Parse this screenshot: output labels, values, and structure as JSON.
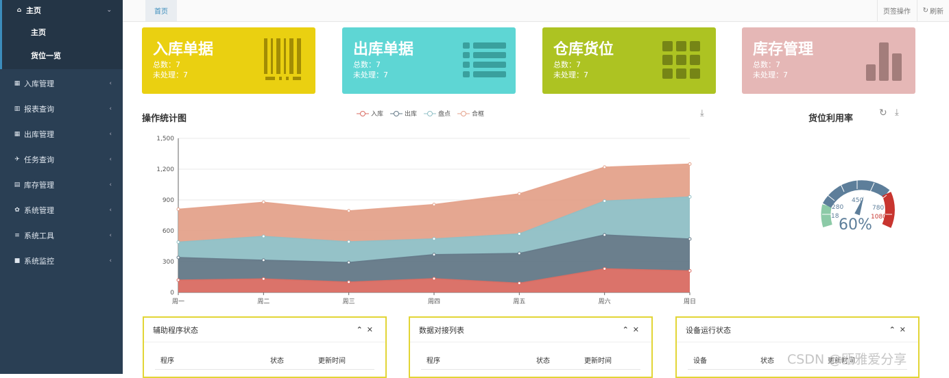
{
  "sidebar": {
    "main_label": "主页",
    "sub_items": [
      "主页",
      "货位一览"
    ],
    "menu": [
      {
        "label": "入库管理",
        "icon": "calculator-icon"
      },
      {
        "label": "报表查询",
        "icon": "bar-chart-icon"
      },
      {
        "label": "出库管理",
        "icon": "calculator-icon"
      },
      {
        "label": "任务查询",
        "icon": "plane-icon"
      },
      {
        "label": "库存管理",
        "icon": "book-icon"
      },
      {
        "label": "系统管理",
        "icon": "gear-icon"
      },
      {
        "label": "系统工具",
        "icon": "bars-icon"
      },
      {
        "label": "系统监控",
        "icon": "video-camera-icon"
      }
    ]
  },
  "topbar": {
    "tab": "首页",
    "page_ops": "页签操作",
    "refresh": "刷新"
  },
  "cards": [
    {
      "title": "入库单据",
      "total": "总数：7",
      "pending": "未处理：7",
      "color": "#ead011",
      "icon": "barcode-icon"
    },
    {
      "title": "出库单据",
      "total": "总数：7",
      "pending": "未处理：7",
      "color": "#5ed6d4",
      "icon": "list-icon"
    },
    {
      "title": "仓库货位",
      "total": "总数：7",
      "pending": "未处理：7",
      "color": "#adc322",
      "icon": "grid-icon"
    },
    {
      "title": "库存管理",
      "total": "总数：7",
      "pending": "未处理：7",
      "color": "#e5b7b6",
      "icon": "bar-chart-icon"
    }
  ],
  "chart_title": "操作统计图",
  "gauge_title": "货位利用率",
  "gauge_value": "60%",
  "gauge_ticks": [
    "450",
    "280",
    "780",
    "18",
    "1080"
  ],
  "chart_data": {
    "type": "area",
    "stacked": true,
    "x": [
      "周一",
      "周二",
      "周三",
      "周四",
      "周五",
      "周六",
      "周日"
    ],
    "ylim": [
      0,
      1500
    ],
    "yticks": [
      "0",
      "300",
      "600",
      "900",
      "1,200",
      "1,500"
    ],
    "series": [
      {
        "name": "入库",
        "values": [
          120,
          132,
          101,
          134,
          90,
          230,
          210
        ],
        "color": "#d96b62"
      },
      {
        "name": "出库",
        "values": [
          220,
          182,
          191,
          234,
          290,
          330,
          310
        ],
        "color": "#637887"
      },
      {
        "name": "盘点",
        "values": [
          150,
          232,
          201,
          154,
          190,
          330,
          410
        ],
        "color": "#8fbfc5"
      },
      {
        "name": "合框",
        "values": [
          320,
          332,
          301,
          334,
          390,
          330,
          320
        ],
        "color": "#e4a28b"
      }
    ]
  },
  "panels": [
    {
      "title": "辅助程序状态",
      "cols": [
        "程序",
        "状态",
        "更新时间"
      ]
    },
    {
      "title": "数据对接列表",
      "cols": [
        "程序",
        "状态",
        "更新时间"
      ]
    },
    {
      "title": "设备运行状态",
      "cols": [
        "设备",
        "状态",
        "更新时间"
      ]
    }
  ],
  "watermark": "CSDN @瓯雅爱分享"
}
